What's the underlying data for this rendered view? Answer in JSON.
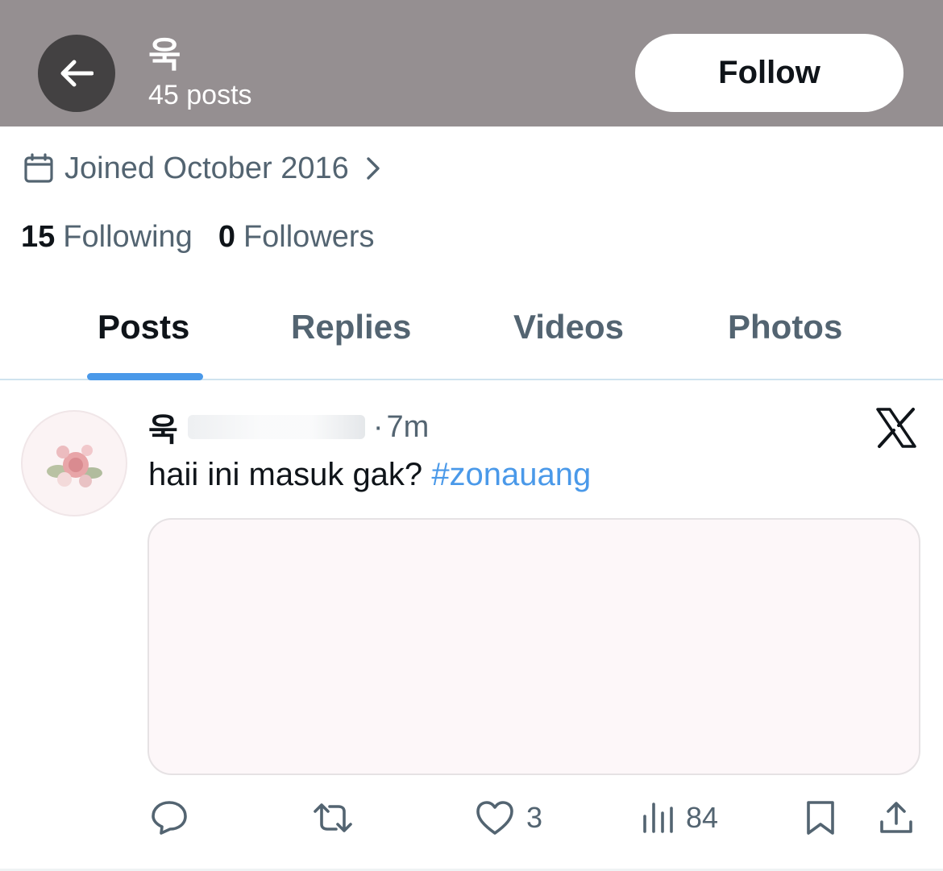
{
  "header": {
    "name": "욱",
    "posts_count": "45 posts",
    "follow_label": "Follow"
  },
  "profile": {
    "joined": "Joined October 2016",
    "following_count": "15",
    "following_label": "Following",
    "followers_count": "0",
    "followers_label": "Followers"
  },
  "tabs": [
    {
      "label": "Posts",
      "active": true
    },
    {
      "label": "Replies",
      "active": false
    },
    {
      "label": "Videos",
      "active": false
    },
    {
      "label": "Photos",
      "active": false
    }
  ],
  "post": {
    "author_name": "욱",
    "separator": "·",
    "time": "7m",
    "text": "haii ini masuk gak?",
    "hashtag": "#zonauang",
    "likes": "3",
    "views": "84"
  },
  "colors": {
    "header_bg": "#958f91",
    "accent": "#4a99e9",
    "secondary_text": "#536471",
    "primary_text": "#0f1419"
  },
  "icons": {
    "back": "arrow-left-icon",
    "calendar": "calendar-icon",
    "chevron": "chevron-right-icon",
    "platform": "x-logo-icon",
    "reply": "reply-icon",
    "repost": "repost-icon",
    "like": "heart-icon",
    "views": "views-icon",
    "bookmark": "bookmark-icon",
    "share": "share-icon"
  }
}
